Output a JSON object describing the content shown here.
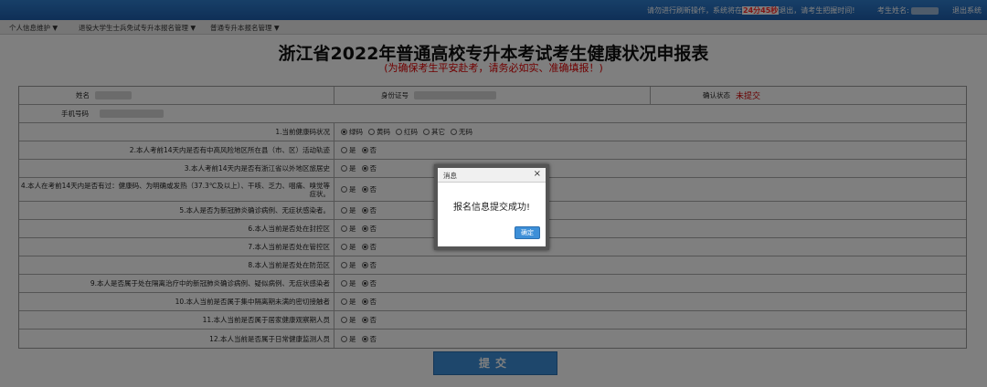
{
  "topbar": {
    "warn_prefix": "请勿进行刷新操作，系统将在",
    "countdown": "24分45秒",
    "warn_suffix": "退出，请考生把握时间!",
    "user_label": "考生姓名:",
    "logout": "退出系统"
  },
  "menu": [
    {
      "label": "个人信息维护 ▼"
    },
    {
      "label": "退役大学生士兵免试专升本报名管理 ▼"
    },
    {
      "label": "普通专升本报名管理 ▼"
    }
  ],
  "page": {
    "title": "浙江省2022年普通高校专升本考试考生健康状况申报表",
    "subtitle": "(为确保考生平安赴考，请务必如实、准确填报！)"
  },
  "form": {
    "name_label": "姓名",
    "id_label": "身份证号",
    "confirm_label": "确认状态",
    "confirm_value": "未提交",
    "phone_label": "手机号码",
    "health_code_label": "1.当前健康码状况",
    "health_code_options": [
      "绿码",
      "黄码",
      "红码",
      "其它",
      "无码"
    ],
    "yes": "是",
    "no": "否",
    "questions": [
      {
        "label": "2.本人考前14天内是否有中高风险地区所在县（市、区）活动轨迹"
      },
      {
        "label": "3.本人考前14天内是否有浙江省以外地区旅居史"
      },
      {
        "label": "4.本人在考前14天内是否有过：健康码、为明确或发热（37.3℃及以上）、干咳、乏力、咽痛、嗅觉等症状。"
      },
      {
        "label": "5.本人是否为新冠肺炎确诊病例、无症状感染者。"
      },
      {
        "label": "6.本人当前是否处在封控区"
      },
      {
        "label": "7.本人当前是否处在管控区"
      },
      {
        "label": "8.本人当前是否处在防范区"
      },
      {
        "label": "9.本人是否属于处在隔离治疗中的新冠肺炎确诊病例、疑似病例、无症状感染者"
      },
      {
        "label": "10.本人当前是否属于集中隔离期未满的密切接触者"
      },
      {
        "label": "11.本人当前是否属于居家健康观察期人员"
      },
      {
        "label": "12.本人当前是否属于日常健康监测人员"
      }
    ]
  },
  "submit_label": "提交",
  "dialog": {
    "title": "消息",
    "close": "×",
    "message": "报名信息提交成功!",
    "ok": "确定"
  }
}
